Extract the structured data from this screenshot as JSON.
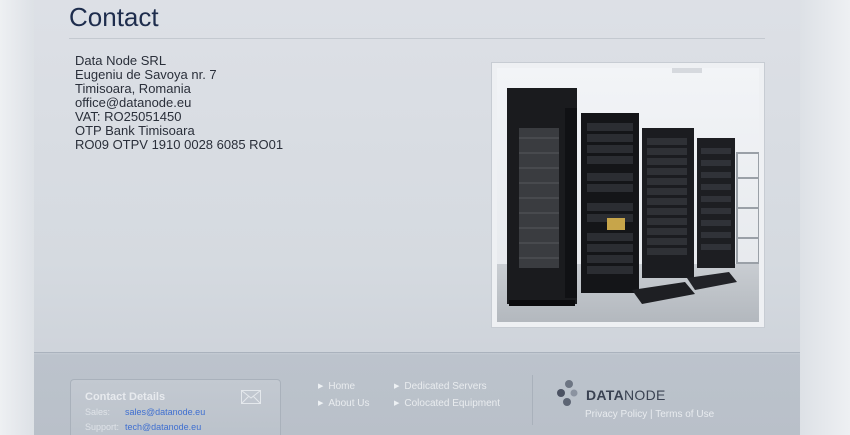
{
  "page": {
    "title": "Contact"
  },
  "address": {
    "lines": [
      "Data Node SRL",
      "Eugeniu de Savoya nr. 7",
      "Timisoara, Romania",
      "office@datanode.eu",
      "VAT: RO25051450",
      "OTP Bank Timisoara",
      "RO09 OTPV 1910 0028 6085 RO01"
    ]
  },
  "footer": {
    "contact_box": {
      "title": "Contact Details",
      "rows": [
        {
          "label": "Sales:",
          "value": "sales@datanode.eu"
        },
        {
          "label": "Support:",
          "value": "tech@datanode.eu"
        }
      ]
    },
    "nav_col1": [
      "Home",
      "About Us"
    ],
    "nav_col2": [
      "Dedicated Servers",
      "Colocated Equipment"
    ],
    "logo": {
      "bold": "DATA",
      "rest": "NODE"
    },
    "privacy": "Privacy Policy",
    "separator": "|",
    "terms": "Terms of Use"
  },
  "icons": {
    "mail": "envelope-icon",
    "arrow": "triangle-right-icon",
    "logo_mark": "datanode-logo-icon"
  },
  "colors": {
    "title": "#1e2d4d",
    "link_blue": "#3f6fd0",
    "footer_bg": "#bcc3cc"
  }
}
